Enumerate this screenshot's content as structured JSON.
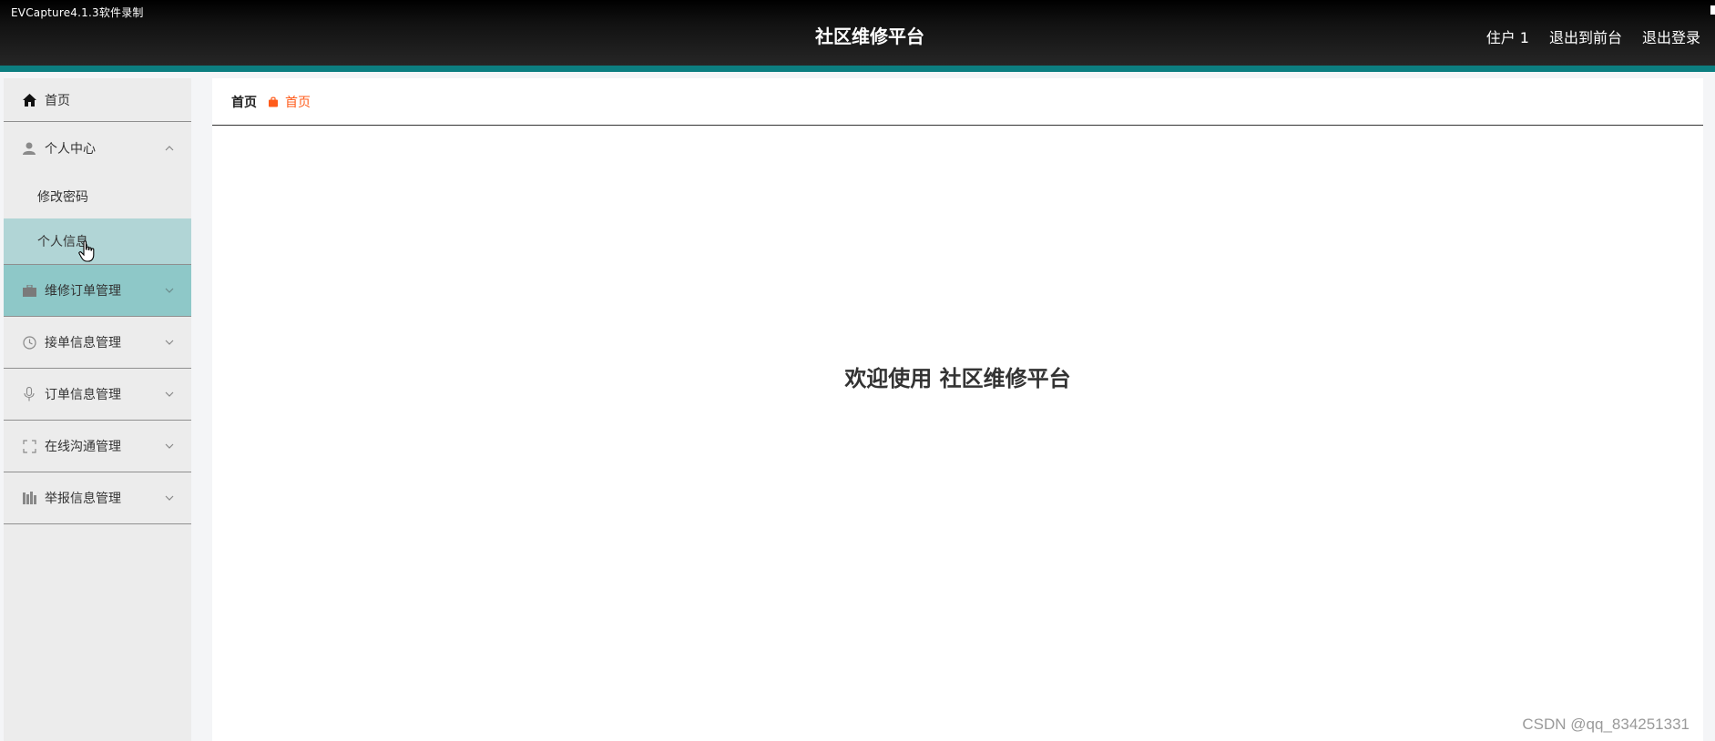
{
  "recorder": {
    "label": "EVCapture4.1.3软件录制"
  },
  "header": {
    "title": "社区维修平台",
    "links": {
      "user": "住户 1",
      "to_front": "退出到前台",
      "logout": "退出登录"
    }
  },
  "sidebar": {
    "home": {
      "label": "首页",
      "icon": "home-icon"
    },
    "personal": {
      "label": "个人中心",
      "icon": "user-icon",
      "expanded": true,
      "children": [
        {
          "label": "修改密码"
        },
        {
          "label": "个人信息",
          "selected": true
        }
      ]
    },
    "groups": [
      {
        "label": "维修订单管理",
        "icon": "briefcase-icon",
        "highlighted": true
      },
      {
        "label": "接单信息管理",
        "icon": "clock-icon"
      },
      {
        "label": "订单信息管理",
        "icon": "microphone-icon"
      },
      {
        "label": "在线沟通管理",
        "icon": "fullscreen-icon"
      },
      {
        "label": "举报信息管理",
        "icon": "books-icon"
      }
    ]
  },
  "breadcrumb": {
    "root": "首页",
    "current": "首页",
    "current_color": "#ff5b1a"
  },
  "main": {
    "welcome": "欢迎使用 社区维修平台"
  },
  "watermark": "CSDN @qq_834251331",
  "colors": {
    "accent_bar": "#0c7e80",
    "active_group_bg": "#8ec8c8",
    "selected_item_bg": "#b1d5d6"
  }
}
